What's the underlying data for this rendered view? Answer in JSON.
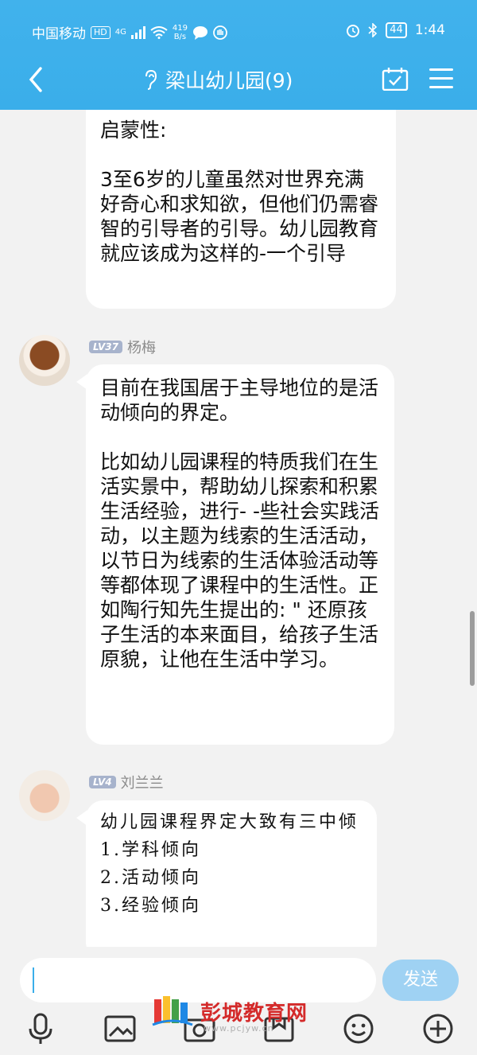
{
  "status_bar": {
    "carrier": "中国移动",
    "hd": "HD",
    "network": "4G",
    "speed_value": "419",
    "speed_unit": "B/s",
    "battery": "44",
    "time": "1:44"
  },
  "header": {
    "title": "梁山幼儿园(9)"
  },
  "messages": [
    {
      "text": "启蒙性:\n\n3至6岁的儿童虽然对世界充满好奇心和求知欲，但他们仍需睿智的引导者的引导。幼儿园教育就应该成为这样的-一个引导"
    },
    {
      "level": "LV37",
      "name": "杨梅",
      "text": "目前在我国居于主导地位的是活动倾向的界定。\n\n比如幼儿园课程的特质我们在生活实景中，帮助幼儿探索和积累生活经验，进行- -些社会实践活动，以主题为线索的生活活动，以节日为线索的生活体验活动等等都体现了课程中的生活性。正如陶行知先生提出的: \" 还原孩子生活的本来面目，给孩子生活原貌，让他在生活中学习。"
    },
    {
      "level": "LV4",
      "name": "刘兰兰",
      "text": "幼儿园课程界定大致有三中倾\n1.学科倾向\n2.活动倾向\n3.经验倾向"
    }
  ],
  "input": {
    "value": "",
    "send_label": "发送"
  },
  "watermark": {
    "text": "彭城教育网",
    "url": "www.pcjyw.cn"
  },
  "icons": [
    "back-icon",
    "ear-icon",
    "calendar-icon",
    "menu-icon",
    "mic-icon",
    "image-icon",
    "camera-icon",
    "folder-icon",
    "emoji-icon",
    "plus-icon"
  ]
}
